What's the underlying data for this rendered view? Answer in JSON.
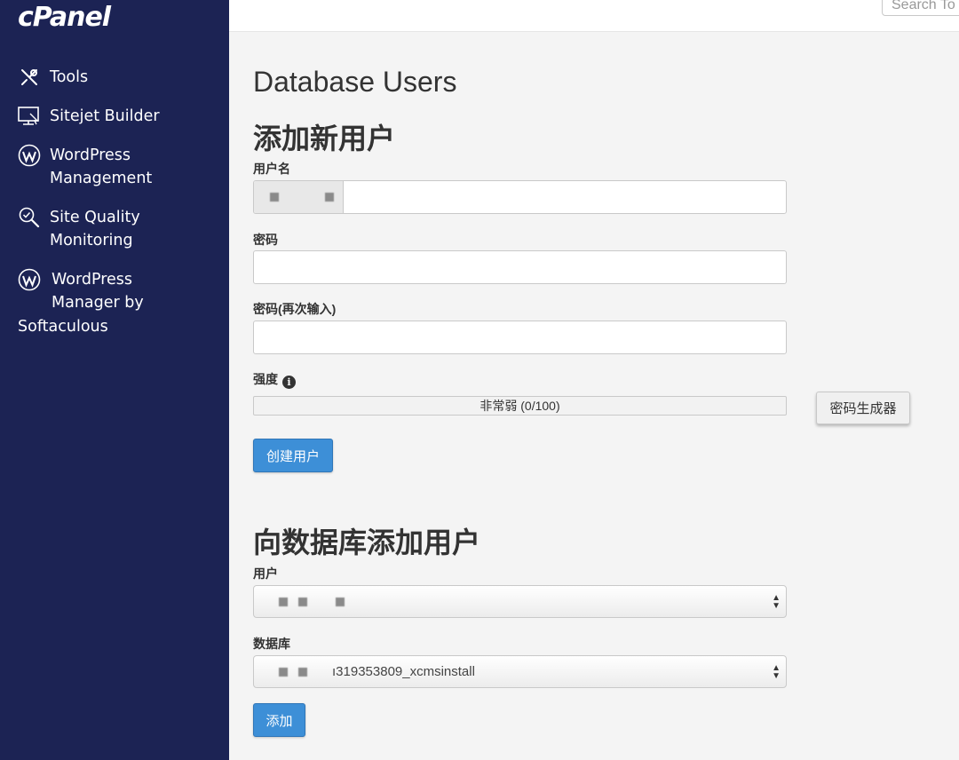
{
  "brand": {
    "logo_text": "cPanel"
  },
  "sidebar": {
    "items": [
      {
        "label": "Tools",
        "icon": "tools-icon"
      },
      {
        "label": "Sitejet Builder",
        "icon": "sitejet-icon"
      },
      {
        "label": "WordPress\nManagement",
        "icon": "wordpress-icon"
      },
      {
        "label": "Site Quality\nMonitoring",
        "icon": "search-quality-icon"
      },
      {
        "label": "WordPress\nManager by",
        "label_extra": "Softaculous",
        "icon": "wordpress-icon"
      }
    ]
  },
  "header": {
    "search_placeholder": "Search To"
  },
  "main": {
    "page_title": "Database Users",
    "add_user": {
      "title": "添加新用户",
      "username_label": "用户名",
      "password_label": "密码",
      "password_again_label": "密码(再次输入)",
      "strength_label": "强度",
      "strength_value": "非常弱 (0/100)",
      "generator_button": "密码生成器",
      "create_button": "创建用户"
    },
    "add_user_to_db": {
      "title": "向数据库添加用户",
      "user_label": "用户",
      "database_label": "数据库",
      "database_value": "ı319353809_xcmsinstall",
      "add_button": "添加"
    }
  },
  "colors": {
    "sidebar_bg": "#1c2354",
    "primary_button": "#3d8fd7"
  }
}
